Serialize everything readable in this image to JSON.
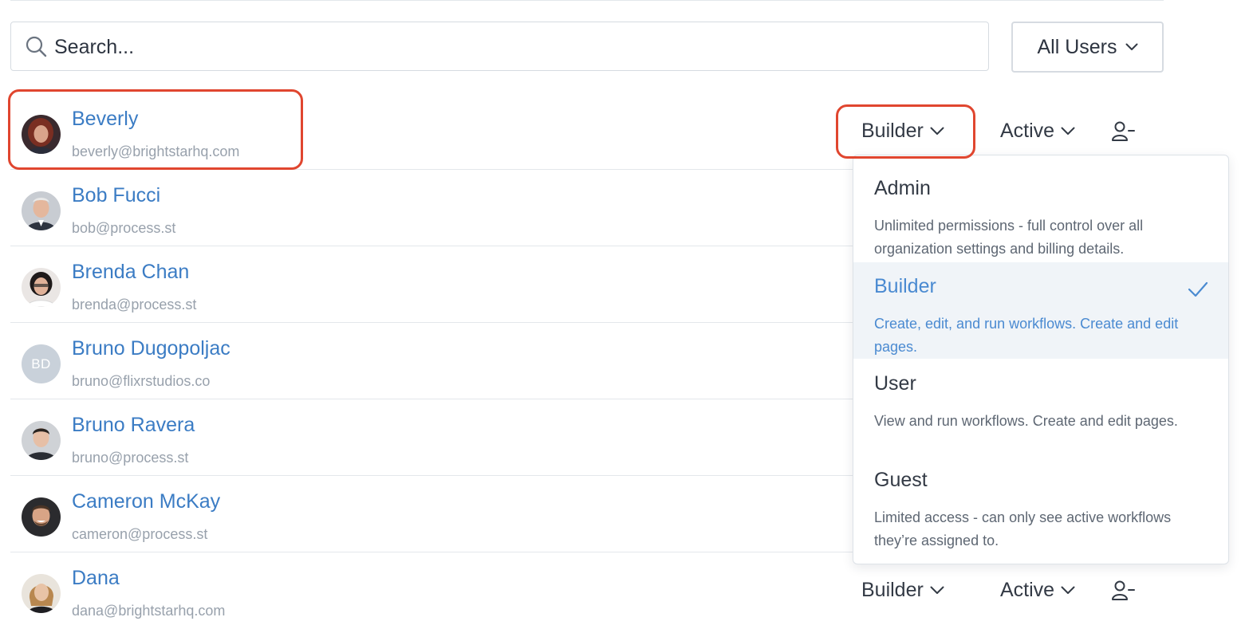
{
  "search": {
    "placeholder": "Search..."
  },
  "filter": {
    "label": "All Users"
  },
  "users": [
    {
      "name": "Beverly",
      "email": "beverly@brightstarhq.com",
      "avatar": "photo"
    },
    {
      "name": "Bob Fucci",
      "email": "bob@process.st",
      "avatar": "photo"
    },
    {
      "name": "Brenda Chan",
      "email": "brenda@process.st",
      "avatar": "photo"
    },
    {
      "name": "Bruno Dugopoljac",
      "email": "bruno@flixrstudios.co",
      "avatar": "initials",
      "initials": "BD"
    },
    {
      "name": "Bruno Ravera",
      "email": "bruno@process.st",
      "avatar": "photo"
    },
    {
      "name": "Cameron McKay",
      "email": "cameron@process.st",
      "avatar": "photo"
    },
    {
      "name": "Dana",
      "email": "dana@brightstarhq.com",
      "avatar": "photo"
    }
  ],
  "row_controls": {
    "first": {
      "role": "Builder",
      "status": "Active"
    },
    "last": {
      "role": "Builder",
      "status": "Active"
    }
  },
  "role_menu": {
    "options": [
      {
        "title": "Admin",
        "description": "Unlimited permissions - full control over all organization settings and billing details.",
        "selected": false
      },
      {
        "title": "Builder",
        "description": "Create, edit, and run workflows. Create and edit pages.",
        "selected": true
      },
      {
        "title": "User",
        "description": "View and run workflows. Create and edit pages.",
        "selected": false
      },
      {
        "title": "Guest",
        "description": "Limited access - can only see active workflows they’re assigned to.",
        "selected": false
      }
    ]
  },
  "colors": {
    "link": "#3b7cc4",
    "muted": "#98a1ac",
    "highlight": "#e0462f",
    "selected_bg": "#f0f4f8",
    "selected_text": "#4a8ad1"
  },
  "icons": {
    "search": "search-icon",
    "chevron": "chevron-down-icon",
    "remove_user": "user-remove-icon",
    "check": "check-icon"
  }
}
